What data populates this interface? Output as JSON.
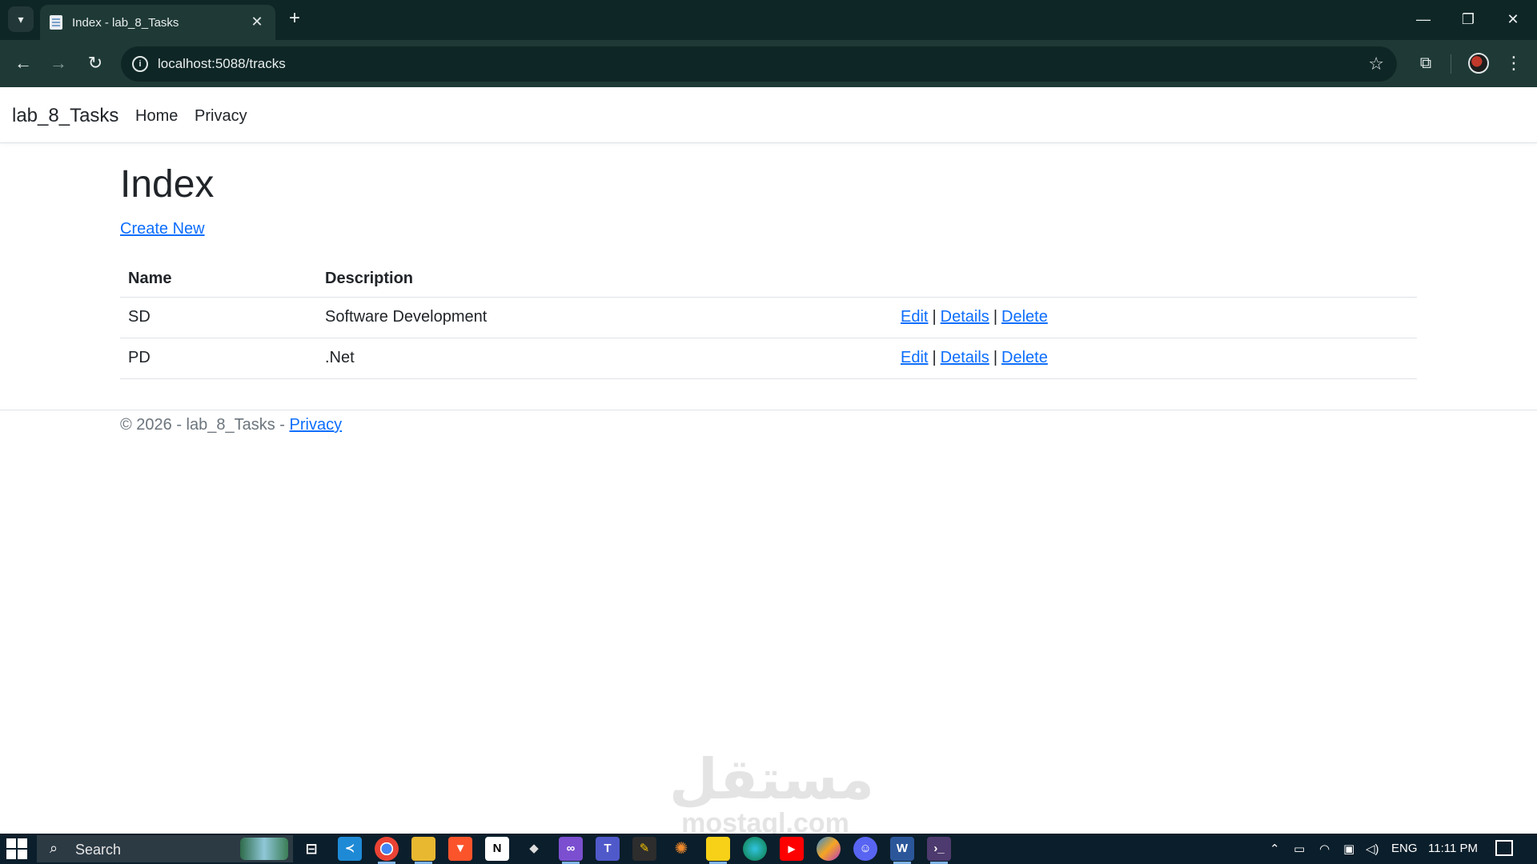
{
  "browser": {
    "tab_title": "Index - lab_8_Tasks",
    "url": "localhost:5088/tracks"
  },
  "navbar": {
    "brand": "lab_8_Tasks",
    "links": [
      "Home",
      "Privacy"
    ]
  },
  "page": {
    "title": "Index",
    "create_link": "Create New",
    "table": {
      "headers": [
        "Name",
        "Description",
        ""
      ],
      "rows": [
        {
          "name": "SD",
          "description": "Software Development"
        },
        {
          "name": "PD",
          "description": ".Net"
        }
      ],
      "actions": [
        "Edit",
        "Details",
        "Delete"
      ],
      "separator": "|"
    }
  },
  "footer": {
    "text": "© 2026 - lab_8_Tasks - ",
    "link": "Privacy"
  },
  "watermark": {
    "arabic": "مستقل",
    "latin": "mostaql.com"
  },
  "taskbar": {
    "search_label": "Search",
    "language": "ENG",
    "time": "11:11 PM"
  },
  "colors": {
    "chrome_dark": "#0f2626",
    "chrome_toolbar": "#1f3a36",
    "link": "#0d6efd",
    "text": "#212529",
    "taskbar": "#0b1e2b"
  }
}
